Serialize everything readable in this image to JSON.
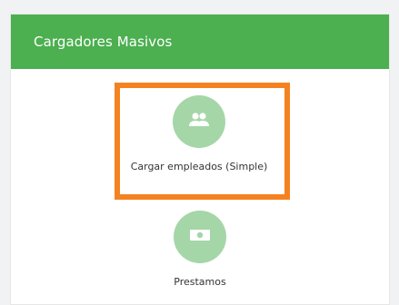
{
  "panel": {
    "title": "Cargadores Masivos",
    "header_color": "#4caf50",
    "tiles": [
      {
        "label": "Cargar empleados (Simple)",
        "icon": "people-icon",
        "highlighted": true
      },
      {
        "label": "Prestamos",
        "icon": "money-icon",
        "highlighted": false
      }
    ]
  },
  "colors": {
    "accent": "#4caf50",
    "icon_circle": "#a5d6a7",
    "highlight": "#f58220"
  }
}
